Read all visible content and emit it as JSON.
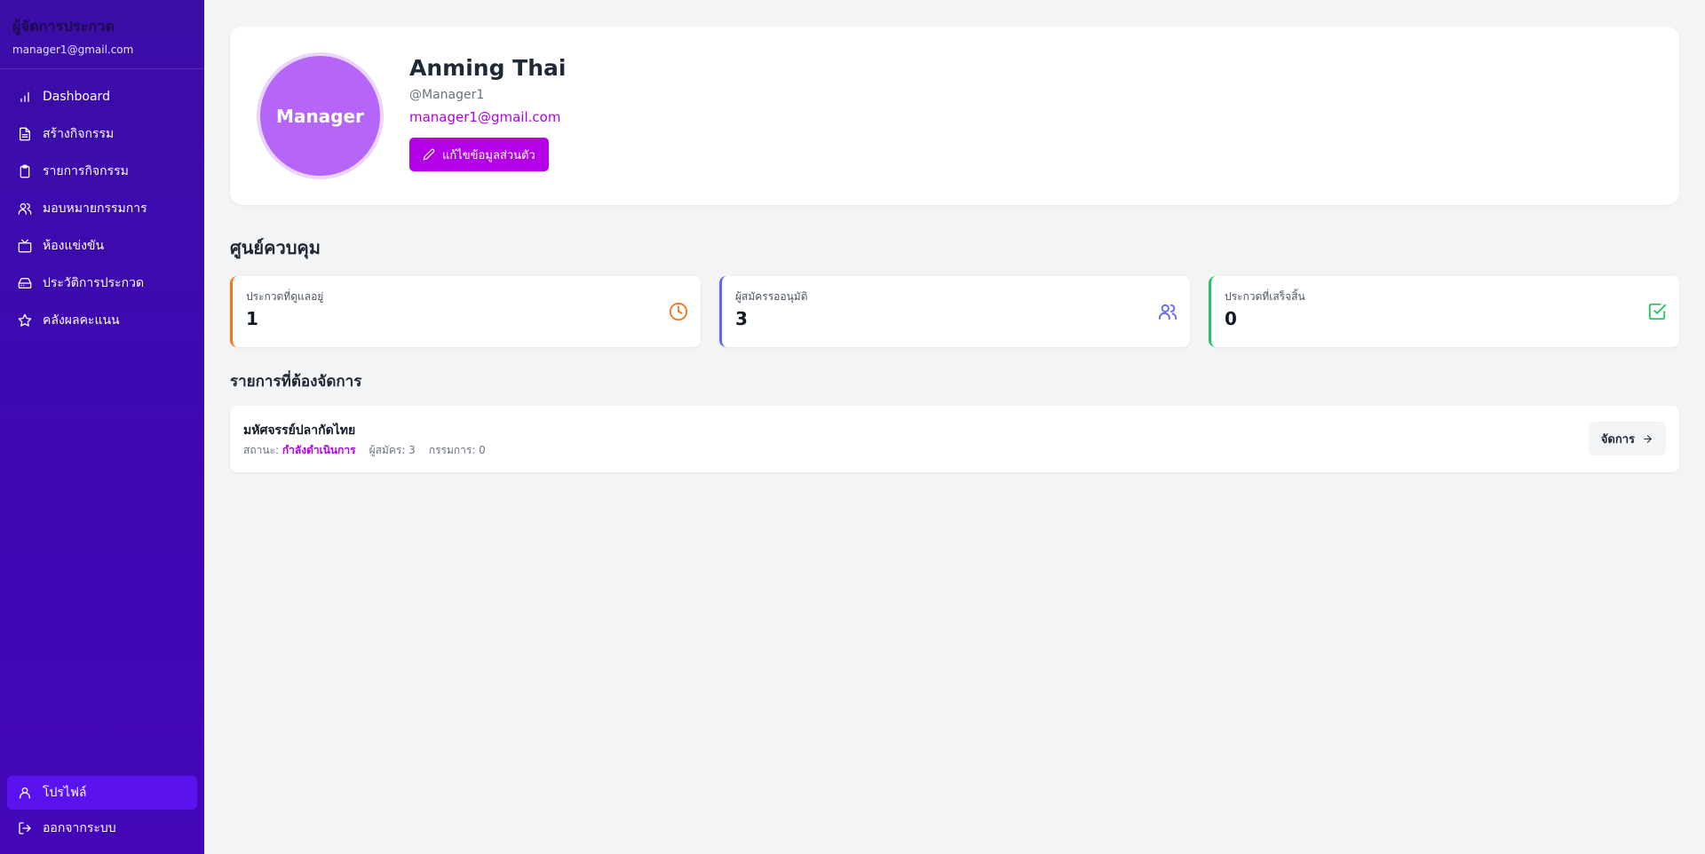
{
  "sidebar": {
    "title": "ผู้จัดการประกวด",
    "email": "manager1@gmail.com",
    "items": [
      {
        "label": "Dashboard",
        "icon": "bar-chart-icon"
      },
      {
        "label": "สร้างกิจกรรม",
        "icon": "file-text-icon"
      },
      {
        "label": "รายการกิจกรรม",
        "icon": "clipboard-icon"
      },
      {
        "label": "มอบหมายกรรมการ",
        "icon": "users-icon"
      },
      {
        "label": "ห้องแข่งขัน",
        "icon": "tv-icon"
      },
      {
        "label": "ประวัติการประกวด",
        "icon": "archive-icon"
      },
      {
        "label": "คลังผลคะแนน",
        "icon": "star-icon"
      }
    ],
    "bottom": {
      "profile_label": "โปรไฟล์",
      "logout_label": "ออกจากระบบ"
    }
  },
  "profile": {
    "avatar_text": "Manager",
    "name": "Anming Thai",
    "handle": "@Manager1",
    "email": "manager1@gmail.com",
    "edit_label": "แก้ไขข้อมูลส่วนตัว"
  },
  "dashboard": {
    "title": "ศูนย์ควบคุม",
    "stats": [
      {
        "label": "ประกวดที่ดูแลอยู่",
        "value": "1",
        "color": "#f97316",
        "icon": "clock-icon"
      },
      {
        "label": "ผู้สมัครรออนุมัติ",
        "value": "3",
        "color": "#6366f1",
        "icon": "users-icon"
      },
      {
        "label": "ประกวดที่เสร็จสิ้น",
        "value": "0",
        "color": "#22c55e",
        "icon": "check-square-icon"
      }
    ]
  },
  "tasks": {
    "title": "รายการที่ต้องจัดการ",
    "items": [
      {
        "name": "มหัศจรรย์ปลากัดไทย",
        "status_prefix": "สถานะ:",
        "status": "กำลังดำเนินการ",
        "applicants": "ผู้สมัคร: 3",
        "judges": "กรรมการ: 0",
        "action_label": "จัดการ"
      }
    ]
  },
  "colors": {
    "accent": "#b400e6",
    "sidebar": "#3f06b4",
    "active_nav": "#5a12ee"
  }
}
